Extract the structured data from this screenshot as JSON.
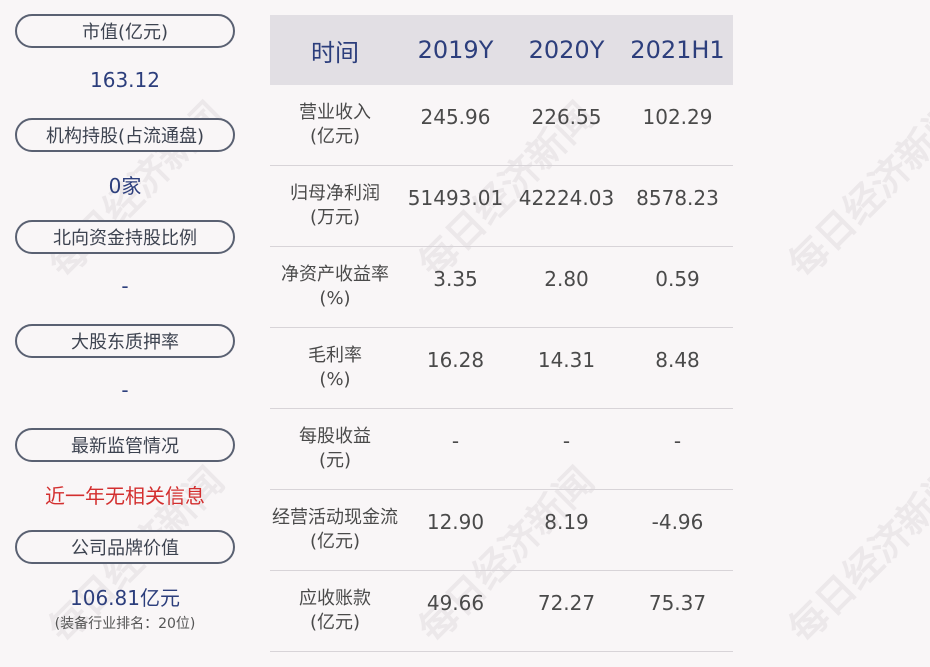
{
  "left": [
    {
      "label": "市值(亿元)",
      "value": "163.12"
    },
    {
      "label": "机构持股(占流通盘)",
      "value": "0家"
    },
    {
      "label": "北向资金持股比例",
      "value": "-"
    },
    {
      "label": "大股东质押率",
      "value": "-"
    },
    {
      "label": "最新监管情况",
      "value": "近一年无相关信息"
    },
    {
      "label": "公司品牌价值",
      "value": "106.81亿元",
      "sub": "(装备行业排名：20位)"
    }
  ],
  "table": {
    "headers": [
      "时间",
      "2019Y",
      "2020Y",
      "2021H1"
    ],
    "rows": [
      {
        "label1": "营业收入",
        "label2": "(亿元)",
        "values": [
          "245.96",
          "226.55",
          "102.29"
        ]
      },
      {
        "label1": "归母净利润",
        "label2": "(万元)",
        "values": [
          "51493.01",
          "42224.03",
          "8578.23"
        ]
      },
      {
        "label1": "净资产收益率",
        "label2": "(%)",
        "values": [
          "3.35",
          "2.80",
          "0.59"
        ]
      },
      {
        "label1": "毛利率",
        "label2": "(%)",
        "values": [
          "16.28",
          "14.31",
          "8.48"
        ]
      },
      {
        "label1": "每股收益",
        "label2": "(元)",
        "values": [
          "-",
          "-",
          "-"
        ]
      },
      {
        "label1": "经营活动现金流",
        "label2": "(亿元)",
        "values": [
          "12.90",
          "8.19",
          "-4.96"
        ]
      },
      {
        "label1": "应收账款",
        "label2": "(亿元)",
        "values": [
          "49.66",
          "72.27",
          "75.37"
        ]
      }
    ]
  },
  "watermark": "每日经济新闻",
  "colors": {
    "value_blue": "#2c3e7c",
    "alert_red": "#d32f2f",
    "header_bg": "#e2dfe4",
    "page_bg": "#f9f6f7"
  }
}
